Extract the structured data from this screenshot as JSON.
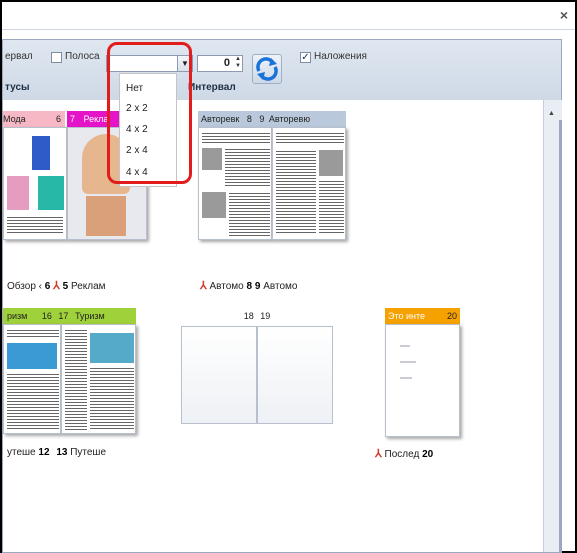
{
  "window": {
    "close_glyph": "×"
  },
  "toolbar": {
    "interval_label": "ервал",
    "stripe_label": "Полоса",
    "grid_value": "",
    "spinner_value": "0",
    "overlay_label": "Наложения",
    "overlay_checked": "✓",
    "statuses_header": "тусы",
    "interval_header": "Интервал"
  },
  "dropdown": {
    "options": [
      "Нет",
      "2 x 2",
      "4 x 2",
      "2 x 4",
      "4 x 4"
    ]
  },
  "spreads": {
    "s1": {
      "label_left": "Мода",
      "num_left": "6",
      "num_right": "7",
      "label_right": "Рекла",
      "cap_left": "Обзор ‹",
      "cap_num_left": "6",
      "cap_num_right": "5",
      "cap_right": "Реклам"
    },
    "s2": {
      "label_left": "Авторевк",
      "num_left": "8",
      "num_right": "9",
      "label_right": "Авторевю",
      "cap_left": "Автомо",
      "cap_num_left": "8",
      "cap_num_right": "9",
      "cap_right": "Автомо"
    },
    "s3": {
      "label_left": "ризм",
      "num_left": "16",
      "num_right": "17",
      "label_right": "Туризм",
      "cap_left": "утеше",
      "cap_num_left": "12",
      "cap_num_right": "13",
      "cap_right": "Путеше"
    },
    "s4": {
      "num_left": "18",
      "num_right": "19"
    },
    "s5": {
      "label_left": "Это инте",
      "num_left": "20",
      "cap_left": "Послед",
      "cap_num_left": "20"
    }
  }
}
